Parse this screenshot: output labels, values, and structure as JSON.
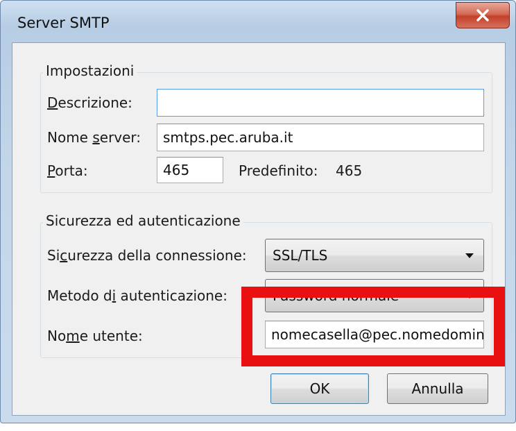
{
  "window": {
    "title": "Server SMTP"
  },
  "close_button": {
    "glyph": "✕"
  },
  "settings": {
    "legend": "Impostazioni",
    "description": {
      "label_pre": "",
      "label_key": "D",
      "label_post": "escrizione:",
      "value": ""
    },
    "server_name": {
      "label_pre": "Nome ",
      "label_key": "s",
      "label_post": "erver:",
      "value": "smtps.pec.aruba.it"
    },
    "port": {
      "label_pre": "",
      "label_key": "P",
      "label_post": "orta:",
      "value": "465"
    },
    "default_label": "Predefinito:",
    "default_value": "465"
  },
  "security": {
    "legend": "Sicurezza ed autenticazione",
    "connection_security": {
      "label_pre": "Si",
      "label_key": "c",
      "label_post": "urezza della connessione:",
      "value": "SSL/TLS"
    },
    "auth_method": {
      "label_pre": "Metodo d",
      "label_key": "i",
      "label_post": " autenticazione:",
      "value": "Password normale"
    },
    "username": {
      "label_pre": "No",
      "label_key": "m",
      "label_post": "e utente:",
      "value": "nomecasella@pec.nomedominio.it"
    }
  },
  "buttons": {
    "ok": "OK",
    "cancel": "Annulla"
  },
  "colors": {
    "highlight": "#e81010",
    "close_button": "#c2412a"
  }
}
